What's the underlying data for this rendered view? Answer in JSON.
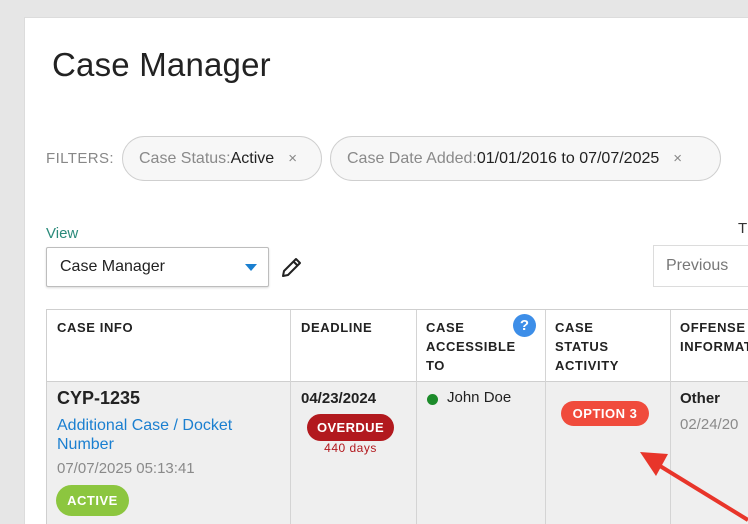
{
  "page": {
    "title": "Case Manager"
  },
  "filters": {
    "label": "FILTERS:",
    "chips": [
      {
        "key": "Case Status",
        "sep": ": ",
        "value": "Active",
        "remove": "×"
      },
      {
        "key": "Case Date Added",
        "sep": ": ",
        "value": "01/01/2016 to 07/07/2025",
        "remove": "×"
      }
    ]
  },
  "view": {
    "label": "View",
    "selected": "Case Manager"
  },
  "pager": {
    "partial_label": "T",
    "previous_label": "Previous"
  },
  "table": {
    "headers": {
      "case_info": "CASE INFO",
      "deadline": "DEADLINE",
      "case_accessible_line1": "CASE",
      "case_accessible_line2": "ACCESSIBLE",
      "case_accessible_line3": "TO",
      "case_status_line1": "CASE",
      "case_status_line2": "STATUS",
      "case_status_line3": "ACTIVITY",
      "offense_line1": "OFFENSE",
      "offense_line2": "INFORMAT"
    },
    "help_glyph": "?",
    "row": {
      "case_id": "CYP-1235",
      "case_link": "Additional Case / Docket Number",
      "case_date": "07/07/2025 05:13:41",
      "status_badge": "ACTIVE",
      "deadline_date": "04/23/2024",
      "overdue_badge": "OVERDUE",
      "overdue_days": "440 days",
      "accessible_to": "John Doe",
      "status_activity": "OPTION 3",
      "offense": "Other",
      "offense_date": "02/24/20"
    }
  },
  "colors": {
    "accent_blue": "#1a7fd0",
    "active_green": "#8cc63f",
    "overdue_red": "#b2191e",
    "option_red": "#f04b3c",
    "annotation_arrow": "#e8352a"
  },
  "icons": {
    "edit": "pencil-icon",
    "help": "question-icon",
    "dropdown": "caret-down-icon",
    "remove": "close-icon"
  }
}
